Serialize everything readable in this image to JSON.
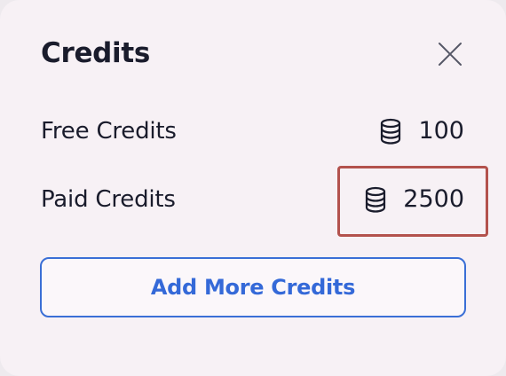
{
  "dialog": {
    "title": "Credits",
    "close_icon": "close-icon"
  },
  "credits": {
    "free": {
      "label": "Free Credits",
      "value": "100",
      "icon": "coins-icon"
    },
    "paid": {
      "label": "Paid Credits",
      "value": "2500",
      "icon": "coins-icon"
    }
  },
  "actions": {
    "add_more_label": "Add More Credits"
  },
  "colors": {
    "accent": "#3469d8",
    "highlight": "#b3524d",
    "text": "#1a1c2c",
    "panel_bg": "#f7f1f5"
  }
}
